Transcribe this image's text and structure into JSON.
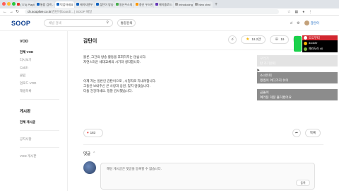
{
  "browser": {
    "tabs": [
      {
        "label": "(773) Playlist",
        "color": "#e53935"
      },
      {
        "label": "통합 검색 - SO",
        "color": "#1565c0"
      },
      {
        "label": "덕업하세요",
        "color": "#1565c0",
        "active": true
      },
      {
        "label": "에이지앤우",
        "color": "#1565c0"
      },
      {
        "label": "감탄이 방송",
        "color": "#1565c0"
      },
      {
        "label": "동산우스의 게",
        "color": "#4caf50"
      },
      {
        "label": "종산 우스빈",
        "color": "#ff9800"
      },
      {
        "label": "해이즐로드 :",
        "color": "#673ab7"
      },
      {
        "label": "Introducing Chat",
        "color": "#9e9e9e"
      },
      {
        "label": "New chat",
        "color": "#9e9e9e"
      }
    ],
    "url_main": "ch.sooplive.co.kr",
    "url_path": "/감탄이/board/... | SOOP 채널",
    "new_tab": "+"
  },
  "header": {
    "logo": "SOOP",
    "search_placeholder": "채널 검색",
    "all_search": "통합검색",
    "user_name": "감탄이"
  },
  "sidebar": {
    "vod_title": "VOD",
    "vod_items": [
      "전체 VOD",
      "다시보기",
      "Catch",
      "클립",
      "업로드 VOD",
      "재생목록"
    ],
    "board_title": "게시판",
    "board_items": [
      "전체 게시글",
      "공지사항",
      "VOD 게시판"
    ]
  },
  "post": {
    "title": "감탄이",
    "favorite_count": "18.2만",
    "sub_count": "19",
    "lines_1": [
      "물론, 그간의 방송 활동을 후회하지는 않습니다.",
      "자연스러운 세대교체의 시기라 생각합니다."
    ],
    "lines_2": [
      "이제 저는 일반인 감탄이으로 , 시청자로 지내려합니다.",
      "그동안 보내주신 큰 사랑과 응원, 잊지 않겠습니다.",
      "다들 건강하세요. 정말 감사했습니다."
    ],
    "like_count": "183",
    "list_button": "목록"
  },
  "comments": {
    "title": "댓글",
    "note": "해당 게시글은 댓글을 등록할 수 없습니다.",
    "submit": "등록"
  },
  "overlay": {
    "head": "도도부터",
    "rows": [
      "dodohr",
      "예라도라 40"
    ]
  },
  "chat": [
    {
      "nick": "꾸러기",
      "text": "탄 조기은퇴",
      "faded": true
    },
    {
      "nick": "소녀유미",
      "text": "찡찡이 어디가지 쉬이",
      "faded": false
    },
    {
      "nick": "곰돌이",
      "text": "여러분 덕분 즐거웠어요",
      "faded": false
    }
  ]
}
